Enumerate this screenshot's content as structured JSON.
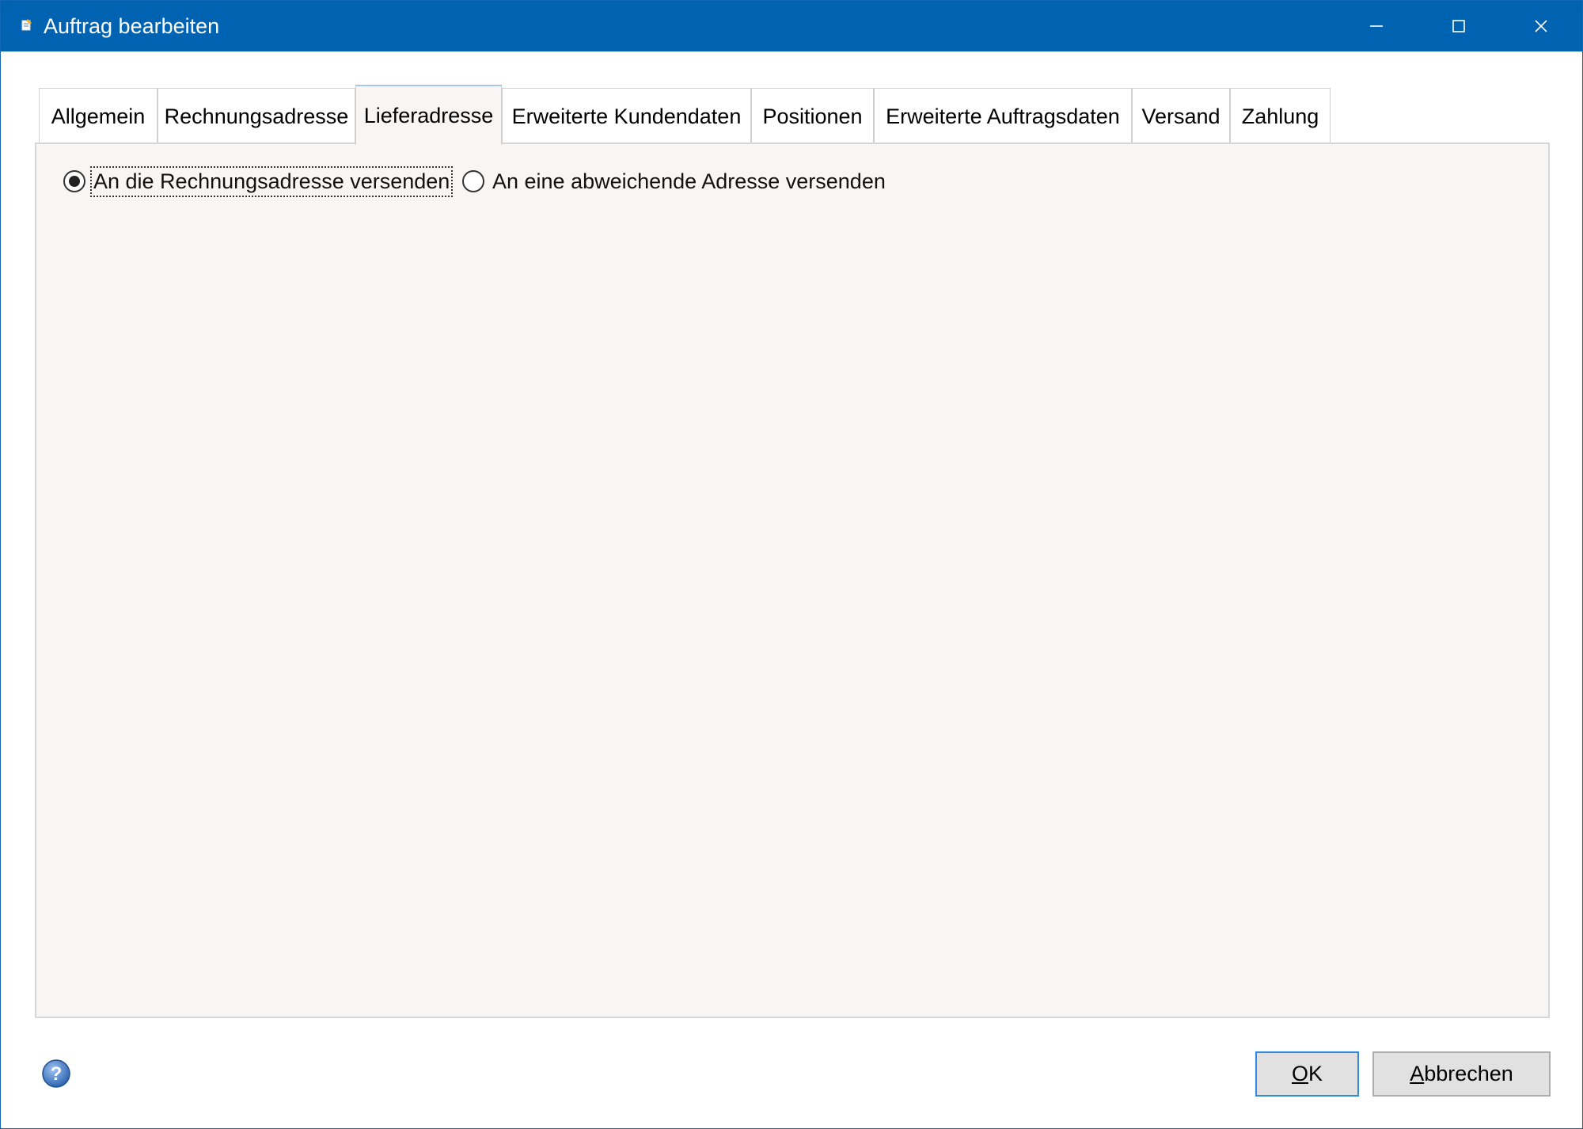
{
  "window": {
    "title": "Auftrag bearbeiten",
    "accent_color": "#0063b1",
    "controls": [
      "minimize-icon",
      "maximize-icon",
      "close-icon"
    ]
  },
  "tabs": [
    {
      "label": "Allgemein",
      "active": false
    },
    {
      "label": "Rechnungsadresse",
      "active": false
    },
    {
      "label": "Lieferadresse",
      "active": true
    },
    {
      "label": "Erweiterte Kundendaten",
      "active": false
    },
    {
      "label": "Positionen",
      "active": false
    },
    {
      "label": "Erweiterte Auftragsdaten",
      "active": false
    },
    {
      "label": "Versand",
      "active": false
    },
    {
      "label": "Zahlung",
      "active": false
    }
  ],
  "delivery": {
    "options": [
      {
        "label": "An die Rechnungsadresse versenden",
        "selected": true
      },
      {
        "label": "An eine abweichende Adresse versenden",
        "selected": false
      }
    ]
  },
  "footer": {
    "help_icon": "help-icon",
    "ok_label": "OK",
    "ok_mnemonic": "O",
    "ok_rest": "K",
    "cancel_label": "Abbrechen",
    "cancel_mnemonic": "A",
    "cancel_rest": "bbrechen"
  }
}
